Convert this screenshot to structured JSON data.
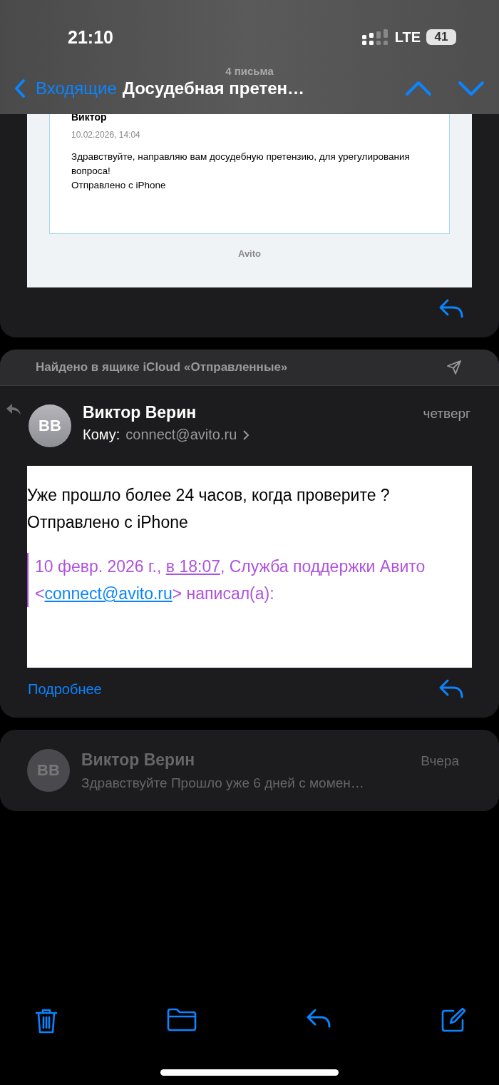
{
  "status_bar": {
    "time": "21:10",
    "network": "LTE",
    "battery": "41"
  },
  "nav": {
    "count": "4 письма",
    "back": "Входящие",
    "title": "Досудебная претен…"
  },
  "quoted_email": {
    "sender": "Виктор",
    "date": "10.02.2026, 14:04",
    "body": [
      "Здравствуйте, направляю вам досудебную претензию, для урегулирования вопроса!",
      "Отправлено с iPhone"
    ],
    "footer": "Avito"
  },
  "message": {
    "banner": "Найдено в ящике iCloud «Отправленные»",
    "initials": "ВВ",
    "sender": "Виктор Верин",
    "date": "четверг",
    "to_label": "Кому:",
    "to": "connect@avito.ru",
    "body": [
      "Уже прошло более 24 часов, когда проверите ?",
      "Отправлено с iPhone"
    ],
    "quote": [
      {
        "kind": "plain",
        "text": "10 февр. 2026 г., "
      },
      {
        "kind": "time-link",
        "text": "в 18:07"
      },
      {
        "kind": "plain",
        "text": ", Служба поддержки Авито <"
      },
      {
        "kind": "mail-link",
        "text": "connect@avito.ru"
      },
      {
        "kind": "plain",
        "text": "> написал(а):"
      }
    ],
    "more": "Подробнее"
  },
  "collapsed_message": {
    "initials": "ВВ",
    "sender": "Виктор Верин",
    "date": "Вчера",
    "preview": "Здравствуйте Прошло уже 6 дней с момен…"
  },
  "toolbar": [
    {
      "kind": "trash"
    },
    {
      "kind": "folder"
    },
    {
      "kind": "reply"
    },
    {
      "kind": "compose"
    }
  ]
}
